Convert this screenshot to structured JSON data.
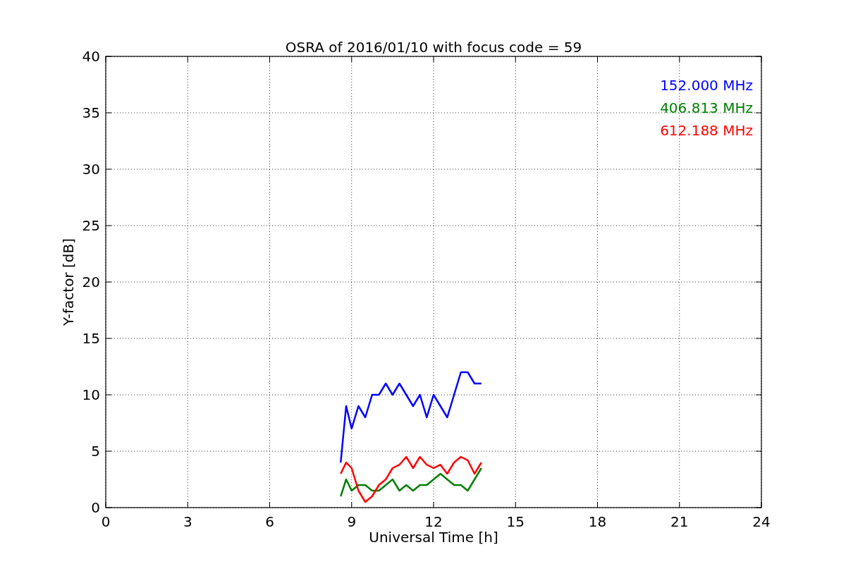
{
  "chart_data": {
    "type": "line",
    "title": "OSRA of 2016/01/10 with focus code = 59",
    "xlabel": "Universal Time [h]",
    "ylabel": "Y-factor [dB]",
    "x": [
      8.6,
      8.8,
      9.0,
      9.25,
      9.5,
      9.75,
      10,
      10.25,
      10.5,
      10.75,
      11,
      11.25,
      11.5,
      11.75,
      12,
      12.25,
      12.5,
      12.75,
      13,
      13.25,
      13.5,
      13.75
    ],
    "series": [
      {
        "name": "152.000 MHz",
        "color": "#0000ff",
        "values": [
          4,
          9,
          7,
          9,
          8,
          10,
          10,
          11,
          10,
          11,
          10,
          9,
          10,
          8,
          10,
          9,
          8,
          10,
          12,
          12,
          11,
          11
        ]
      },
      {
        "name": "406.813 MHz",
        "color": "#008000",
        "values": [
          1,
          2.5,
          1.5,
          2,
          2,
          1.5,
          1.5,
          2,
          2.5,
          1.5,
          2,
          1.5,
          2,
          2,
          2.5,
          3,
          2.5,
          2,
          2,
          1.5,
          2.5,
          3.5
        ]
      },
      {
        "name": "612.188 MHz",
        "color": "#ff0000",
        "values": [
          3,
          4,
          3.5,
          1.5,
          0.5,
          1,
          2,
          2.5,
          3.5,
          3.8,
          4.5,
          3.5,
          4.5,
          3.8,
          3.5,
          3.8,
          3,
          4,
          4.5,
          4.2,
          3,
          4
        ]
      }
    ],
    "xlim": [
      0,
      24
    ],
    "ylim": [
      0,
      40
    ],
    "xticks": [
      0,
      3,
      6,
      9,
      12,
      15,
      18,
      21,
      24
    ],
    "yticks": [
      0,
      5,
      10,
      15,
      20,
      25,
      30,
      35,
      40
    ],
    "grid": true
  }
}
